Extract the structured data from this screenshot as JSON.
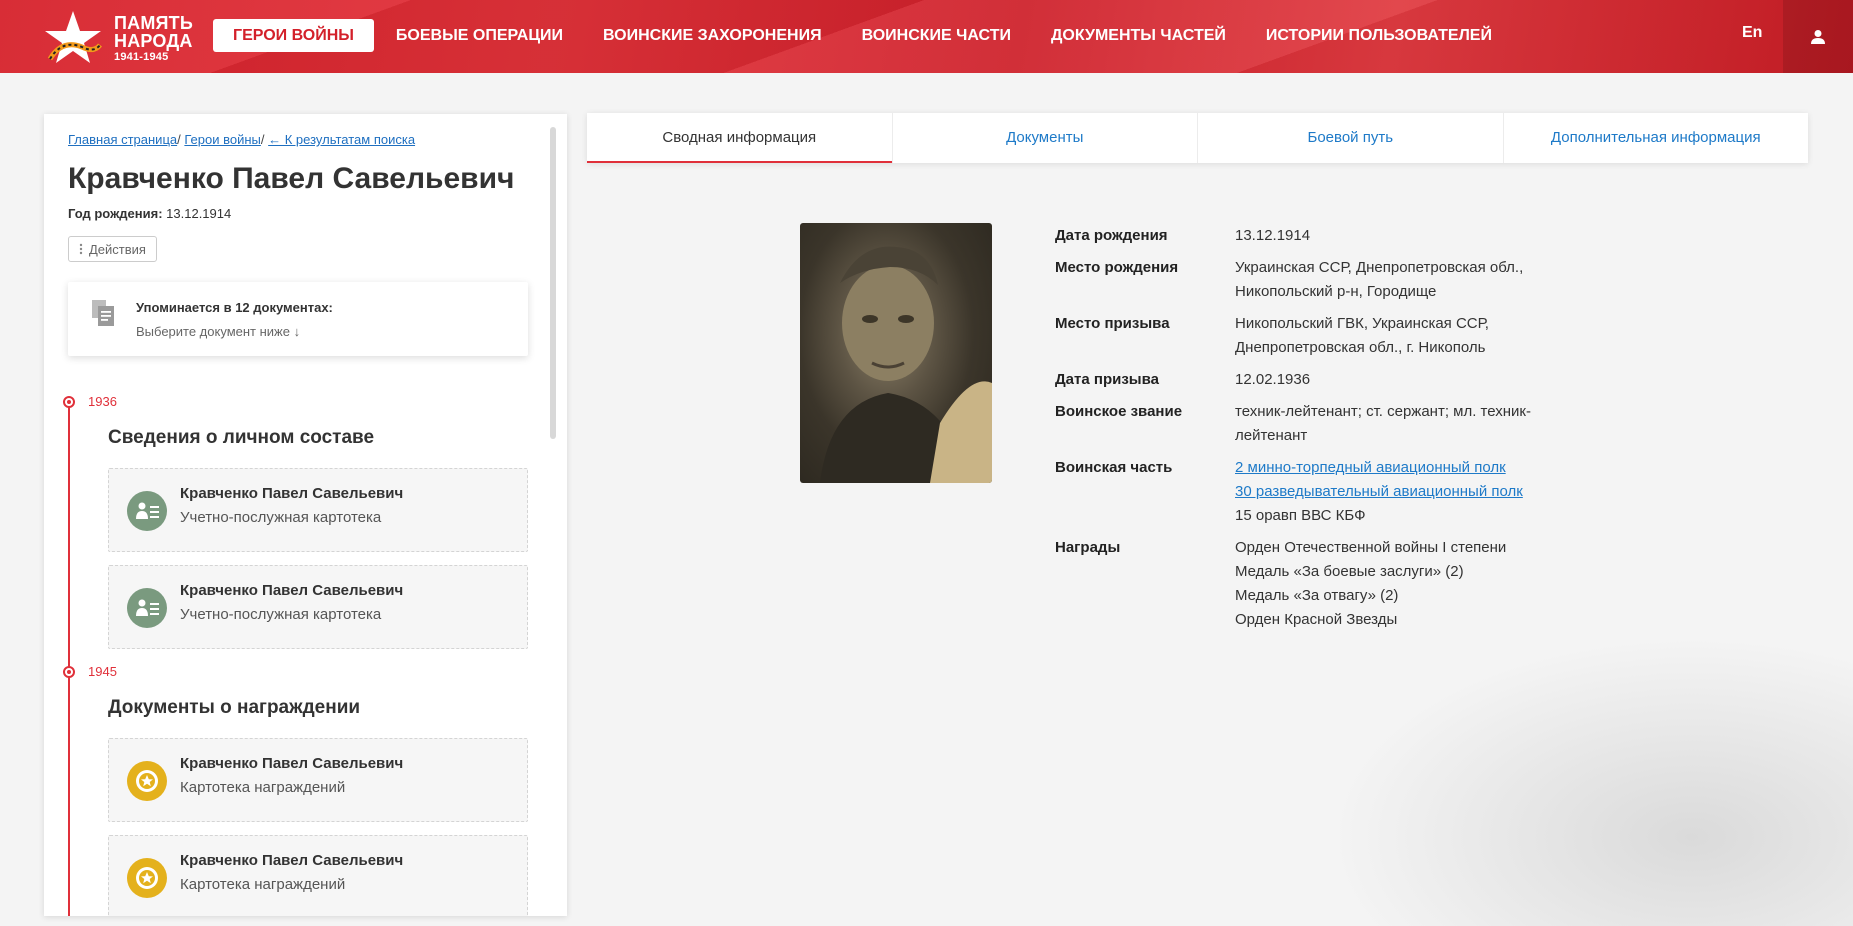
{
  "header": {
    "logo_line1": "ПАМЯТЬ",
    "logo_line2": "НАРОДА",
    "logo_years": "1941-1945",
    "nav": [
      {
        "label": "ГЕРОИ ВОЙНЫ",
        "active": true
      },
      {
        "label": "БОЕВЫЕ ОПЕРАЦИИ"
      },
      {
        "label": "ВОИНСКИЕ ЗАХОРОНЕНИЯ"
      },
      {
        "label": "ВОИНСКИЕ ЧАСТИ"
      },
      {
        "label": "ДОКУМЕНТЫ ЧАСТЕЙ"
      },
      {
        "label": "ИСТОРИИ ПОЛЬЗОВАТЕЛЕЙ"
      }
    ],
    "lang": "En",
    "user_icon": "user-icon"
  },
  "left": {
    "breadcrumb": {
      "home": "Главная страница",
      "heroes": "Герои войны",
      "back": "← К результатам поиска",
      "sep": "/"
    },
    "name": "Кравченко Павел Савельевич",
    "birth_label": "Год рождения:",
    "birth_value": "13.12.1914",
    "actions_label": "Действия",
    "mention": {
      "title": "Упоминается в 12 документах:",
      "sub": "Выберите документ ниже ↓"
    },
    "timeline": [
      {
        "year": "1936",
        "title": "Сведения о личном составе",
        "docs": [
          {
            "name": "Кравченко Павел Савельевич",
            "type": "Учетно-послужная картотека",
            "icon": "personnel-card-icon"
          },
          {
            "name": "Кравченко Павел Савельевич",
            "type": "Учетно-послужная картотека",
            "icon": "personnel-card-icon"
          }
        ]
      },
      {
        "year": "1945",
        "title": "Документы о награждении",
        "docs": [
          {
            "name": "Кравченко Павел Савельевич",
            "type": "Картотека награждений",
            "icon": "award-medal-icon"
          },
          {
            "name": "Кравченко Павел Савельевич",
            "type": "Картотека награждений",
            "icon": "award-medal-icon"
          }
        ]
      }
    ]
  },
  "tabs": [
    {
      "label": "Сводная информация",
      "active": true
    },
    {
      "label": "Документы"
    },
    {
      "label": "Боевой путь"
    },
    {
      "label": "Дополнительная информация"
    }
  ],
  "info": {
    "birth_date": {
      "label": "Дата рождения",
      "value": "13.12.1914"
    },
    "birth_place": {
      "label": "Место рождения",
      "value": "Украинская ССР, Днепропетровская обл., Никопольский р-н, Городище"
    },
    "draft_place": {
      "label": "Место призыва",
      "value": "Никопольский ГВК, Украинская ССР, Днепропетровская обл., г. Никополь"
    },
    "draft_date": {
      "label": "Дата призыва",
      "value": "12.02.1936"
    },
    "rank": {
      "label": "Воинское звание",
      "value": "техник-лейтенант; ст. сержант; мл. техник-лейтенант"
    },
    "unit": {
      "label": "Воинская часть",
      "links": [
        "2 минно-торпедный авиационный полк",
        "30 разведывательный авиационный полк"
      ],
      "text": "15 оравп ВВС КБФ"
    },
    "awards": {
      "label": "Награды",
      "items": [
        "Орден Отечественной войны I степени",
        "Медаль «За боевые заслуги» (2)",
        "Медаль «За отвагу» (2)",
        "Орден Красной Звезды"
      ]
    }
  },
  "colors": {
    "brand_red": "#d6202a",
    "link_blue": "#1e7ac8",
    "award_gold": "#e4b11c",
    "personnel_green": "#7a9a7f"
  }
}
